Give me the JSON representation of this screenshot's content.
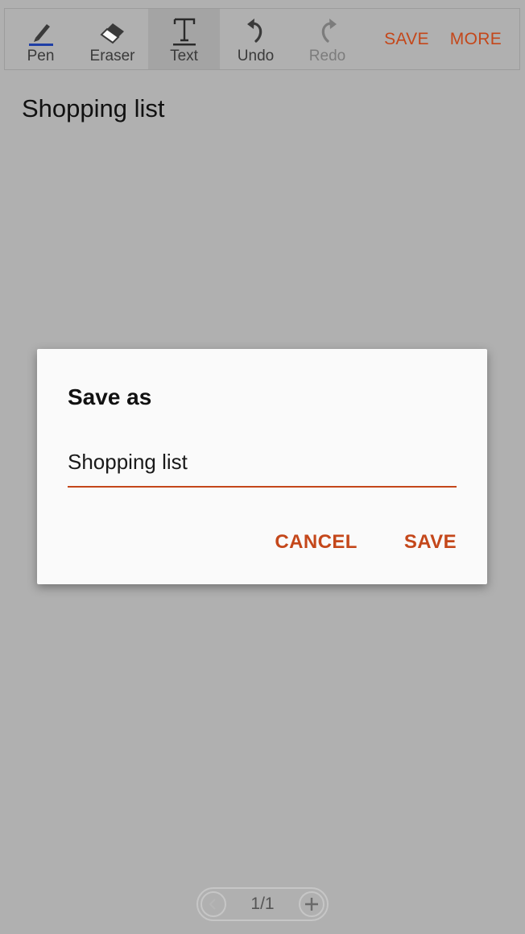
{
  "toolbar": {
    "tools": [
      {
        "label": "Pen",
        "icon": "pen-icon"
      },
      {
        "label": "Eraser",
        "icon": "eraser-icon"
      },
      {
        "label": "Text",
        "icon": "text-icon",
        "selected": true
      },
      {
        "label": "Undo",
        "icon": "undo-icon"
      },
      {
        "label": "Redo",
        "icon": "redo-icon",
        "disabled": true
      }
    ],
    "save_label": "SAVE",
    "more_label": "MORE"
  },
  "note": {
    "title": "Shopping list"
  },
  "dialog": {
    "title": "Save as",
    "input_value": "Shopping list",
    "cancel_label": "CANCEL",
    "save_label": "SAVE"
  },
  "pager": {
    "page_indicator": "1/1",
    "prev_icon": "chevron-left-icon",
    "add_icon": "plus-icon"
  },
  "colors": {
    "accent": "#c4471a",
    "scrim_background": "#b0b0b0",
    "dialog_background": "#fafafa",
    "pen_underline": "#1f3fa6"
  }
}
